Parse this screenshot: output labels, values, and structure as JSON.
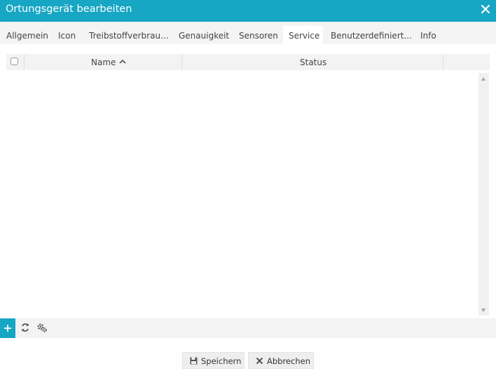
{
  "window": {
    "title": "Ortungsgerät bearbeiten"
  },
  "tabs": [
    "Allgemein",
    "Icon",
    "Treibstoffverbrau...",
    "Genauigkeit",
    "Sensoren",
    "Service",
    "Benutzerdefiniert...",
    "Info"
  ],
  "active_tab": "Service",
  "grid": {
    "columns": {
      "name": "Name",
      "status": "Status"
    },
    "sort_column": "Name",
    "sort_direction": "ascending",
    "rows": []
  },
  "buttons": {
    "save": "Speichern",
    "cancel": "Abbrechen"
  },
  "icons": {
    "close": "close-icon",
    "add": "plus-icon",
    "refresh": "refresh-icon",
    "settings": "gear-icon",
    "save": "floppy-disk-icon",
    "cancel": "cross-icon",
    "sort": "chevron-up-icon"
  },
  "colors": {
    "accent": "#17a6c4",
    "titlebar_text": "#ffffff"
  }
}
